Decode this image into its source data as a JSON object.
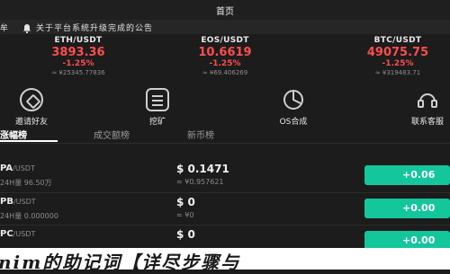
{
  "header": {
    "title": "首页"
  },
  "notice": {
    "prefix": "牟",
    "text": "关于平台系统升级完成的公告"
  },
  "tickers": [
    {
      "name": "ETH/USDT",
      "price": "3893.36",
      "change": "-1.25%",
      "sub": "≈ ¥25345.77836"
    },
    {
      "name": "EOS/USDT",
      "price": "10.6619",
      "change": "-1.25%",
      "sub": "≈ ¥69.406269"
    },
    {
      "name": "BTC/USDT",
      "price": "49075.75",
      "change": "-1.25%",
      "sub": "≈ ¥319483.71"
    }
  ],
  "menu": [
    {
      "label": "邀请好友",
      "icon": "invite-icon"
    },
    {
      "label": "挖矿",
      "icon": "mining-icon"
    },
    {
      "label": "OS合成",
      "icon": "synthesis-icon"
    },
    {
      "label": "联系客服",
      "icon": "support-icon"
    }
  ],
  "tabs": [
    {
      "label": "涨幅榜",
      "active": true
    },
    {
      "label": "成交额榜",
      "active": false
    },
    {
      "label": "新币榜",
      "active": false
    }
  ],
  "rows": [
    {
      "base": "PA",
      "quote": "/USDT",
      "vol": "24H量 96.50万",
      "price": "$ 0.1471",
      "cny": "≈ ¥0.957621",
      "change": "+0.06"
    },
    {
      "base": "PB",
      "quote": "/USDT",
      "vol": "24H量 0.000000",
      "price": "$ 0",
      "cny": "≈ ¥0",
      "change": "+0.00"
    },
    {
      "base": "PC",
      "quote": "/USDT",
      "vol": "",
      "price": "$ 0",
      "cny": "",
      "change": "+0.00"
    }
  ],
  "banner": {
    "text": "nim的助记词【详尽步骤与"
  },
  "colors": {
    "down": "#ff4d4d",
    "up": "#14c69b",
    "bg": "#1c1c1c"
  }
}
